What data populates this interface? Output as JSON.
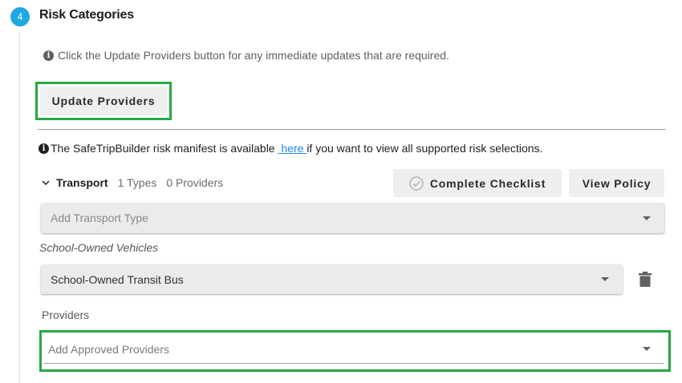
{
  "section": {
    "step_number": "4",
    "title": "Risk Categories",
    "accent_color": "#1ea7e1",
    "highlight_color": "#27a844"
  },
  "info_note": "Click the Update Providers button for any immediate updates that are required.",
  "update_button_label": "Update Providers",
  "manifest": {
    "text_before": "The SafeTripBuilder risk manifest is available ",
    "link_text": " here ",
    "text_after": "if you want to view all supported risk selections."
  },
  "transport": {
    "label": "Transport",
    "types_count": "1 Types",
    "providers_count": "0 Providers",
    "complete_checklist_label": "Complete Checklist",
    "view_policy_label": "View Policy",
    "add_type_placeholder": "Add Transport Type"
  },
  "vehicle_group": {
    "label": "School-Owned Vehicles",
    "selected_value": "School-Owned Transit Bus"
  },
  "providers": {
    "label": "Providers",
    "placeholder": "Add Approved Providers"
  },
  "icons": [
    "info-icon",
    "chevron-down-icon",
    "check-circle-icon",
    "dropdown-arrow-icon",
    "trash-icon"
  ]
}
